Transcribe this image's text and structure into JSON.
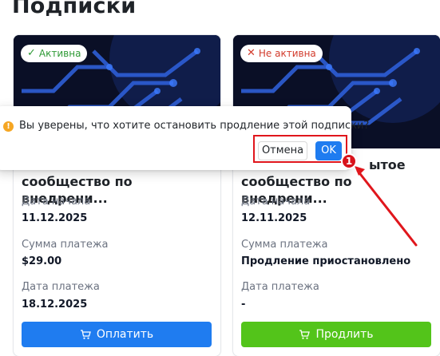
{
  "page": {
    "title": "Подписки"
  },
  "cards": [
    {
      "status_label": "Активна",
      "status_icon": "check-icon",
      "status_color": "#2f9a36",
      "title_visible": "сообщество по внедрени...",
      "fields": [
        {
          "label": "Дата начала",
          "value": "11.12.2025"
        },
        {
          "label": "Сумма платежа",
          "value": "$29.00"
        },
        {
          "label": "Дата платежа",
          "value": "18.12.2025"
        }
      ],
      "button_label": "Оплатить",
      "button_color": "#1f7cf0"
    },
    {
      "status_label": "Не активна",
      "status_icon": "close-icon",
      "status_color": "#d23b2c",
      "title_line1_visible": "ытое",
      "title_line2_visible": "сообщество по внедрени...",
      "fields": [
        {
          "label": "Дата начала",
          "value": "12.11.2025"
        },
        {
          "label": "Сумма платежа",
          "value": "Продление приостановлено"
        },
        {
          "label": "Дата платежа",
          "value": "-"
        }
      ],
      "button_label": "Продлить",
      "button_color": "#53c41a"
    }
  ],
  "popconfirm": {
    "message": "Вы уверены, что хотите остановить продление этой подписки?",
    "cancel_label": "Отмена",
    "ok_label": "OK",
    "icon": "warning-icon"
  },
  "annotation": {
    "step_number": "1",
    "color": "#e0161c"
  }
}
